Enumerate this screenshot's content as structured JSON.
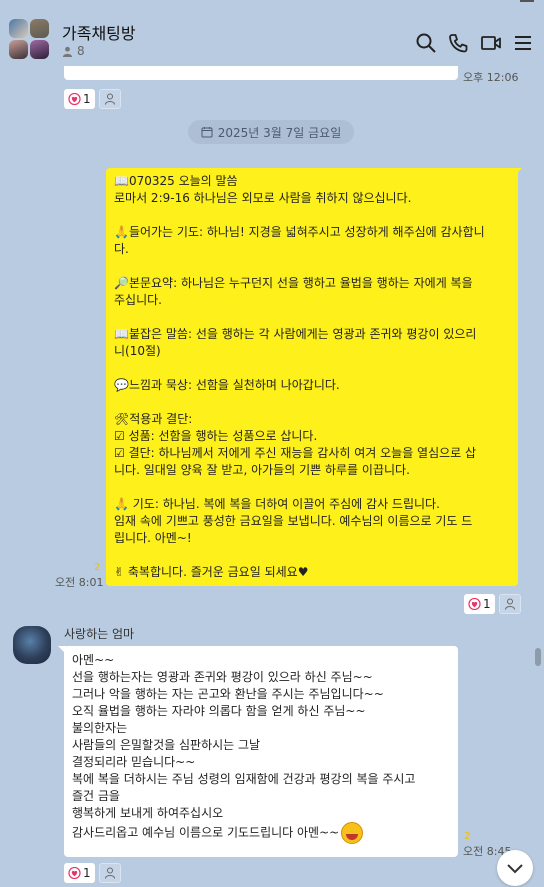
{
  "header": {
    "title": "가족채팅방",
    "member_count": "8"
  },
  "first_message": {
    "time": "오후 12:06",
    "reaction_count": "1"
  },
  "date_divider": "2025년 3월 7일 금요일",
  "yellow_message": {
    "lines": [
      "📖070325 오늘의 말씀",
      "로마서 2:9-16 하나님은 외모로 사람을 취하지 않으십니다.",
      "",
      "🙏들어가는 기도: 하나님! 지경을 넓혀주시고 성장하게 해주심에 감사합니",
      "다.",
      "",
      "🔎본문요약: 하나님은 누구던지 선을 행하고 율법을 행하는 자에게 복을",
      "주십니다.",
      "",
      "📖붙잡은 말씀: 선을 행하는 각 사람에게는 영광과 존귀와 평강이 있으리",
      "니(10절)",
      "",
      "💬느낌과 묵상: 선함을 실천하며 나아갑니다.",
      "",
      "🛠적용과 결단:",
      "☑ 성품: 선함을 행하는 성품으로 삽니다.",
      "☑ 결단: 하나님께서 저에게 주신 재능을 감사히 여겨 오늘을 열심으로 삽",
      "니다. 일대일 양육 잘 받고, 아가들의 기쁜 하루를 이끕니다.",
      "",
      "🙏 기도: 하나님. 복에 복을 더하여 이끌어 주심에 감사 드립니다.",
      "임재 속에 기쁘고 풍성한 금요일을 보냅니다. 예수님의 이름으로 기도 드",
      "립니다. 아멘~!",
      "",
      "✌ 축복합니다. 즐거운 금요일 되세요♥"
    ],
    "unread": "2",
    "time": "오전 8:01",
    "reaction_count": "1"
  },
  "white_message": {
    "sender": "사랑하는 엄마",
    "lines": [
      "아멘~~",
      "선을 행하는자는 영광과 존귀와 평강이 있으라 하신 주님~~",
      "그러나 악을 행하는 자는 곤고와 환난을 주시는 주님입니다~~",
      "오직 율법을 행하는 자라야 의롭다 함을 얻게 하신 주님~~",
      "불의한자는",
      "사람들의 은밀할것을 심판하시는 그날",
      "결정되리라 믿습니다~~",
      "복에 복을 더하시는 주님 성령의 임재함에 건강과 평강의 복을 주시고",
      "즐건 금을",
      "행복하게 보내게 하여주십시오",
      "감사드리옵고 예수님 이름으로 기도드립니다 아멘~~"
    ],
    "unread": "2",
    "time": "오전 8:45",
    "reaction_count": "1"
  },
  "colors": {
    "background": "#b9cbe0",
    "my_bubble": "#fef01b",
    "other_bubble": "#ffffff",
    "heart": "#e8336a"
  },
  "icons": [
    "search-icon",
    "phone-icon",
    "video-icon",
    "menu-icon",
    "person-icon",
    "heart-icon",
    "calendar-icon",
    "chevron-down-icon"
  ]
}
